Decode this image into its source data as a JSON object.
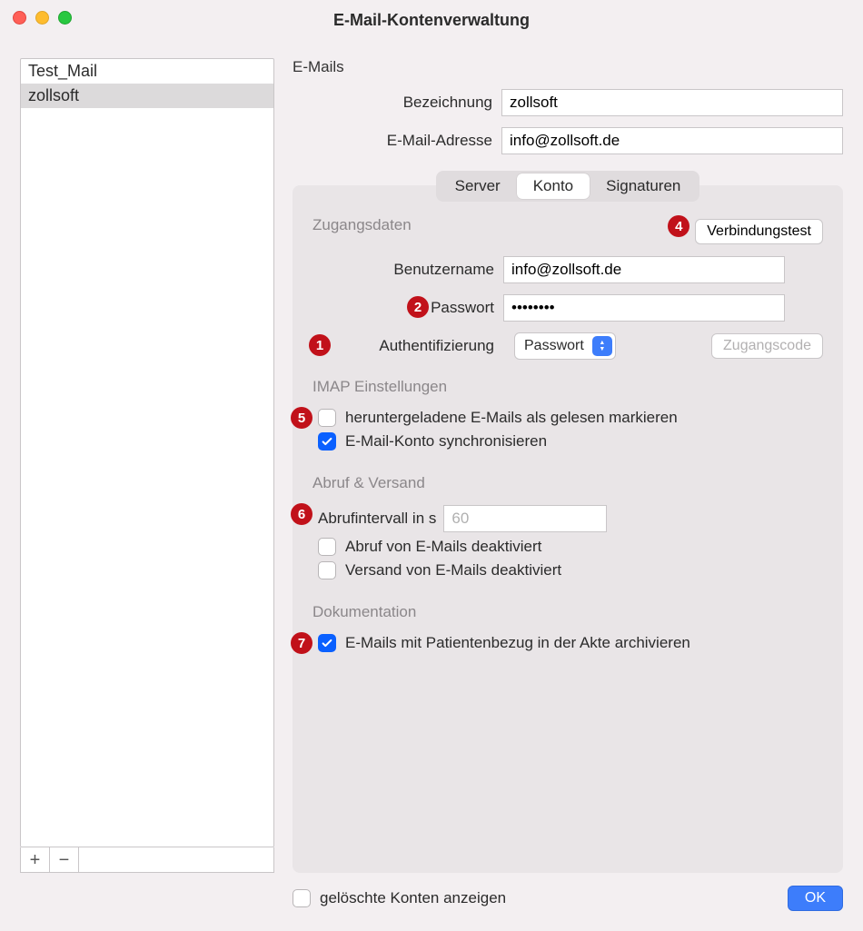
{
  "window": {
    "title": "E-Mail-Kontenverwaltung"
  },
  "accounts": {
    "items": [
      "Test_Mail",
      "zollsoft"
    ],
    "selected_index": 1
  },
  "top": {
    "section_label": "E-Mails",
    "bezeichnung_label": "Bezeichnung",
    "bezeichnung_value": "zollsoft",
    "email_label": "E-Mail-Adresse",
    "email_value": "info@zollsoft.de"
  },
  "tabs": {
    "server": "Server",
    "konto": "Konto",
    "signaturen": "Signaturen",
    "active": "konto"
  },
  "zugang": {
    "heading": "Zugangsdaten",
    "verbindung_btn": "Verbindungstest",
    "benutzer_label": "Benutzername",
    "benutzer_value": "info@zollsoft.de",
    "passwort_label": "Passwort",
    "passwort_value": "••••••••",
    "auth_label": "Authentifizierung",
    "auth_value": "Passwort",
    "zugangscode_btn": "Zugangscode"
  },
  "imap": {
    "heading": "IMAP Einstellungen",
    "mark_read_label": "heruntergeladene E-Mails als gelesen markieren",
    "mark_read_checked": false,
    "sync_label": "E-Mail-Konto synchronisieren",
    "sync_checked": true
  },
  "abruf": {
    "heading": "Abruf & Versand",
    "interval_label": "Abrufintervall in s",
    "interval_placeholder": "60",
    "fetch_disabled_label": "Abruf von E-Mails deaktiviert",
    "fetch_disabled_checked": false,
    "send_disabled_label": "Versand von E-Mails deaktiviert",
    "send_disabled_checked": false
  },
  "doku": {
    "heading": "Dokumentation",
    "archive_label": "E-Mails mit Patientenbezug in der Akte archivieren",
    "archive_checked": true
  },
  "bottom": {
    "show_deleted_label": "gelöschte Konten anzeigen",
    "ok_label": "OK"
  },
  "annotations": {
    "1": "1",
    "2": "2",
    "4": "4",
    "5": "5",
    "6": "6",
    "7": "7"
  }
}
